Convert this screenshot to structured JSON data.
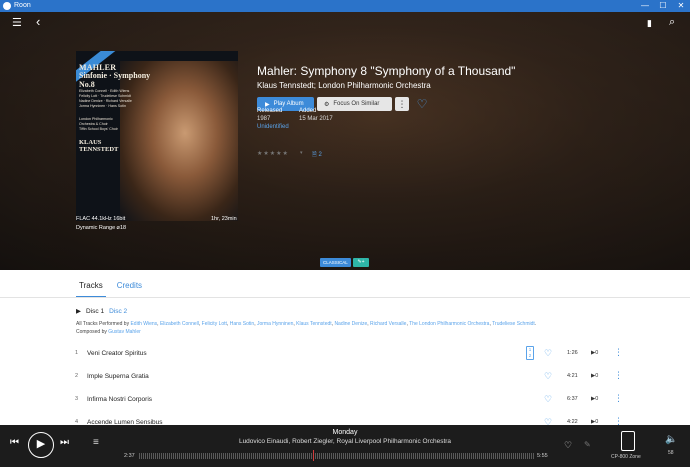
{
  "window": {
    "title": "Roon",
    "minimize": "—",
    "maximize": "☐",
    "close": "✕"
  },
  "topnav": {
    "menu_icon": "☰",
    "back_icon": "‹",
    "bookmark_icon": "▮",
    "search_icon": "⌕"
  },
  "cover": {
    "line1": "MAHLER",
    "line2": "Sinfonie · Symphony",
    "line3": "No.8",
    "soloists": [
      "Elizabeth Connell · Edith Wiens",
      "Felicity Lott · Trudeliese Schmidt",
      "Nadine Denize · Richard Versalle",
      "Jorma Hynninen · Hans Sotin"
    ],
    "choirs": [
      "London Philharmonic",
      "Orchestra & Choir",
      "Tiffin School Boys' Choir"
    ],
    "conductor": [
      "KLAUS",
      "TENNSTEDT"
    ]
  },
  "cover_meta": {
    "format": "FLAC 44.1kHz 16bit",
    "duration": "1hr, 23min",
    "dynamic_range": "Dynamic Range ⌀18"
  },
  "album": {
    "title": "Mahler: Symphony 8 \"Symphony of a Thousand\"",
    "artist": "Klaus Tennstedt; London Philharmonic Orchestra",
    "play_label": "Play Album",
    "play_icon": "▶",
    "focus_label": "Focus On Similar",
    "focus_icon": "⚙",
    "more_icon": "⋮",
    "heart_icon": "♡",
    "released_label": "Released",
    "released_value": "1987",
    "identified_status": "Unidentified",
    "added_label": "Added",
    "added_value": "15 Mar 2017",
    "stars": "★★★★★",
    "stars_caret": "▾",
    "pages_icon": "🗎",
    "pages_count": "2"
  },
  "tags": {
    "genre": "CLASSICAL",
    "add_tag_icon": "✎+"
  },
  "tabs": [
    {
      "label": "Tracks"
    },
    {
      "label": "Credits"
    }
  ],
  "discs": {
    "arrow": "▶",
    "disc1": "Disc 1",
    "disc2": "Disc 2"
  },
  "performers": {
    "prefix": "All Tracks Performed by",
    "names": [
      "Edith Wiens",
      "Elizabeth Connell",
      "Felicity Lott",
      "Hans Sotin",
      "Jorma Hynninen",
      "Klaus Tennstedt",
      "Nadine Denize",
      "Richard Versalle",
      "The London Philharmonic Orchestra",
      "Trudeliese Schmidt"
    ],
    "composed_prefix": "Composed by",
    "composer": "Gustav Mahler"
  },
  "tracks": [
    {
      "num": "1",
      "title": "Veni Creator Spiritus",
      "duration": "1:26",
      "plays": "▶0",
      "pager": "1 2"
    },
    {
      "num": "2",
      "title": "Imple Superna Gratia",
      "duration": "4:21",
      "plays": "▶0"
    },
    {
      "num": "3",
      "title": "Infirma Nostri Corporis",
      "duration": "6:37",
      "plays": "▶0"
    },
    {
      "num": "4",
      "title": "Accende Lumen Sensibus",
      "duration": "4:22",
      "plays": "▶0"
    }
  ],
  "track_icons": {
    "heart": "♡",
    "menu": "⋮"
  },
  "now_playing": {
    "title": "Monday",
    "artists": "Ludovico Einaudi, Robert Ziegler, Royal Liverpool Philharmonic Orchestra",
    "elapsed": "2:37",
    "total": "5:55",
    "progress_fraction": 0.44,
    "prev_icon": "⏮",
    "play_icon": "▶",
    "next_icon": "⏭",
    "queue_icon": "≡",
    "heart_icon": "♡",
    "pin_icon": "✎",
    "zone": "CP-800 Zone",
    "volume": "58",
    "volume_icon": "🔈"
  },
  "colors": {
    "accent": "#3d8bd9",
    "titlebar": "#2b73c9",
    "tag_teal": "#2eb5a8",
    "progress": "#d23c3c"
  }
}
